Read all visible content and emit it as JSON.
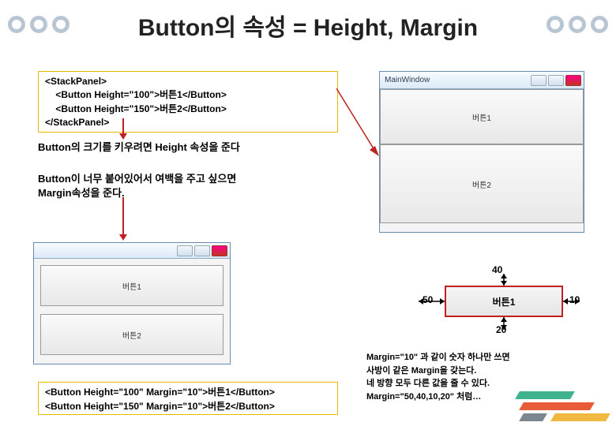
{
  "title": "Button의 속성 = Height, Margin",
  "code1": {
    "l1": "<StackPanel>",
    "l2": "    <Button Height=\"100\">버튼1</Button>",
    "l3": "    <Button Height=\"150\">버튼2</Button>",
    "l4": "</StackPanel>"
  },
  "text1": "Button의 크기를 키우려면 Height 속성을 준다",
  "text2": "Button이 너무 붙어있어서 여백을 주고 싶으면\nMargin속성을 준다.",
  "code2": {
    "l1": "<Button Height=\"100\" Margin=\"10\">버튼1</Button>",
    "l2": "<Button Height=\"150\" Margin=\"10\">버튼2</Button>"
  },
  "mock": {
    "title": "MainWindow",
    "btn1": "버튼1",
    "btn2": "버튼2"
  },
  "margin_diagram": {
    "top": "40",
    "right": "10",
    "bottom": "20",
    "left": "50",
    "label": "버튼1"
  },
  "text3": "Margin=\"10\" 과 같이 숫자 하나만 쓰면\n사방이 같은 Margin을 갖는다.\n네 방향 모두 다른 값을 줄 수 있다.\nMargin=\"50,40,10,20\" 처럼…"
}
